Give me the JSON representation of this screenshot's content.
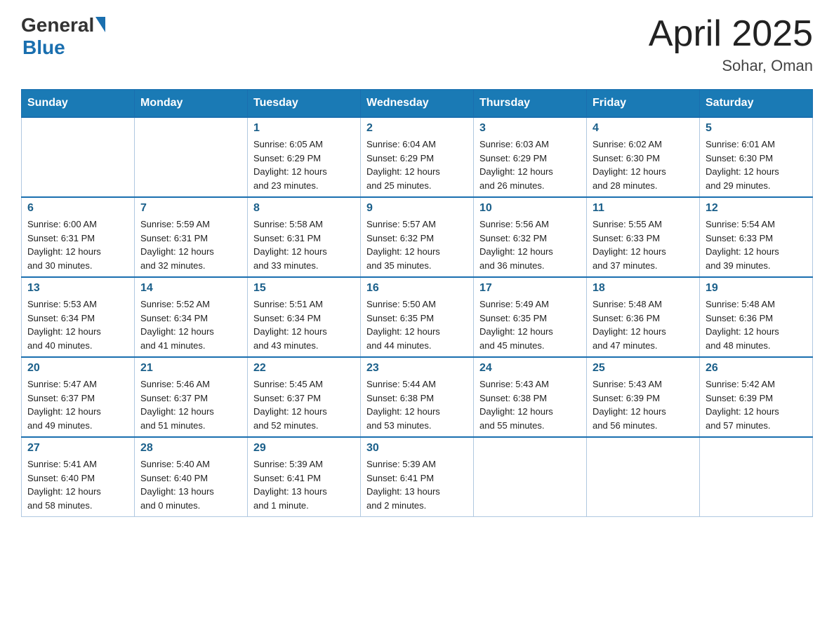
{
  "logo": {
    "general": "General",
    "blue": "Blue"
  },
  "title": "April 2025",
  "subtitle": "Sohar, Oman",
  "days_header": [
    "Sunday",
    "Monday",
    "Tuesday",
    "Wednesday",
    "Thursday",
    "Friday",
    "Saturday"
  ],
  "weeks": [
    [
      {
        "day": "",
        "info": ""
      },
      {
        "day": "",
        "info": ""
      },
      {
        "day": "1",
        "info": "Sunrise: 6:05 AM\nSunset: 6:29 PM\nDaylight: 12 hours\nand 23 minutes."
      },
      {
        "day": "2",
        "info": "Sunrise: 6:04 AM\nSunset: 6:29 PM\nDaylight: 12 hours\nand 25 minutes."
      },
      {
        "day": "3",
        "info": "Sunrise: 6:03 AM\nSunset: 6:29 PM\nDaylight: 12 hours\nand 26 minutes."
      },
      {
        "day": "4",
        "info": "Sunrise: 6:02 AM\nSunset: 6:30 PM\nDaylight: 12 hours\nand 28 minutes."
      },
      {
        "day": "5",
        "info": "Sunrise: 6:01 AM\nSunset: 6:30 PM\nDaylight: 12 hours\nand 29 minutes."
      }
    ],
    [
      {
        "day": "6",
        "info": "Sunrise: 6:00 AM\nSunset: 6:31 PM\nDaylight: 12 hours\nand 30 minutes."
      },
      {
        "day": "7",
        "info": "Sunrise: 5:59 AM\nSunset: 6:31 PM\nDaylight: 12 hours\nand 32 minutes."
      },
      {
        "day": "8",
        "info": "Sunrise: 5:58 AM\nSunset: 6:31 PM\nDaylight: 12 hours\nand 33 minutes."
      },
      {
        "day": "9",
        "info": "Sunrise: 5:57 AM\nSunset: 6:32 PM\nDaylight: 12 hours\nand 35 minutes."
      },
      {
        "day": "10",
        "info": "Sunrise: 5:56 AM\nSunset: 6:32 PM\nDaylight: 12 hours\nand 36 minutes."
      },
      {
        "day": "11",
        "info": "Sunrise: 5:55 AM\nSunset: 6:33 PM\nDaylight: 12 hours\nand 37 minutes."
      },
      {
        "day": "12",
        "info": "Sunrise: 5:54 AM\nSunset: 6:33 PM\nDaylight: 12 hours\nand 39 minutes."
      }
    ],
    [
      {
        "day": "13",
        "info": "Sunrise: 5:53 AM\nSunset: 6:34 PM\nDaylight: 12 hours\nand 40 minutes."
      },
      {
        "day": "14",
        "info": "Sunrise: 5:52 AM\nSunset: 6:34 PM\nDaylight: 12 hours\nand 41 minutes."
      },
      {
        "day": "15",
        "info": "Sunrise: 5:51 AM\nSunset: 6:34 PM\nDaylight: 12 hours\nand 43 minutes."
      },
      {
        "day": "16",
        "info": "Sunrise: 5:50 AM\nSunset: 6:35 PM\nDaylight: 12 hours\nand 44 minutes."
      },
      {
        "day": "17",
        "info": "Sunrise: 5:49 AM\nSunset: 6:35 PM\nDaylight: 12 hours\nand 45 minutes."
      },
      {
        "day": "18",
        "info": "Sunrise: 5:48 AM\nSunset: 6:36 PM\nDaylight: 12 hours\nand 47 minutes."
      },
      {
        "day": "19",
        "info": "Sunrise: 5:48 AM\nSunset: 6:36 PM\nDaylight: 12 hours\nand 48 minutes."
      }
    ],
    [
      {
        "day": "20",
        "info": "Sunrise: 5:47 AM\nSunset: 6:37 PM\nDaylight: 12 hours\nand 49 minutes."
      },
      {
        "day": "21",
        "info": "Sunrise: 5:46 AM\nSunset: 6:37 PM\nDaylight: 12 hours\nand 51 minutes."
      },
      {
        "day": "22",
        "info": "Sunrise: 5:45 AM\nSunset: 6:37 PM\nDaylight: 12 hours\nand 52 minutes."
      },
      {
        "day": "23",
        "info": "Sunrise: 5:44 AM\nSunset: 6:38 PM\nDaylight: 12 hours\nand 53 minutes."
      },
      {
        "day": "24",
        "info": "Sunrise: 5:43 AM\nSunset: 6:38 PM\nDaylight: 12 hours\nand 55 minutes."
      },
      {
        "day": "25",
        "info": "Sunrise: 5:43 AM\nSunset: 6:39 PM\nDaylight: 12 hours\nand 56 minutes."
      },
      {
        "day": "26",
        "info": "Sunrise: 5:42 AM\nSunset: 6:39 PM\nDaylight: 12 hours\nand 57 minutes."
      }
    ],
    [
      {
        "day": "27",
        "info": "Sunrise: 5:41 AM\nSunset: 6:40 PM\nDaylight: 12 hours\nand 58 minutes."
      },
      {
        "day": "28",
        "info": "Sunrise: 5:40 AM\nSunset: 6:40 PM\nDaylight: 13 hours\nand 0 minutes."
      },
      {
        "day": "29",
        "info": "Sunrise: 5:39 AM\nSunset: 6:41 PM\nDaylight: 13 hours\nand 1 minute."
      },
      {
        "day": "30",
        "info": "Sunrise: 5:39 AM\nSunset: 6:41 PM\nDaylight: 13 hours\nand 2 minutes."
      },
      {
        "day": "",
        "info": ""
      },
      {
        "day": "",
        "info": ""
      },
      {
        "day": "",
        "info": ""
      }
    ]
  ]
}
